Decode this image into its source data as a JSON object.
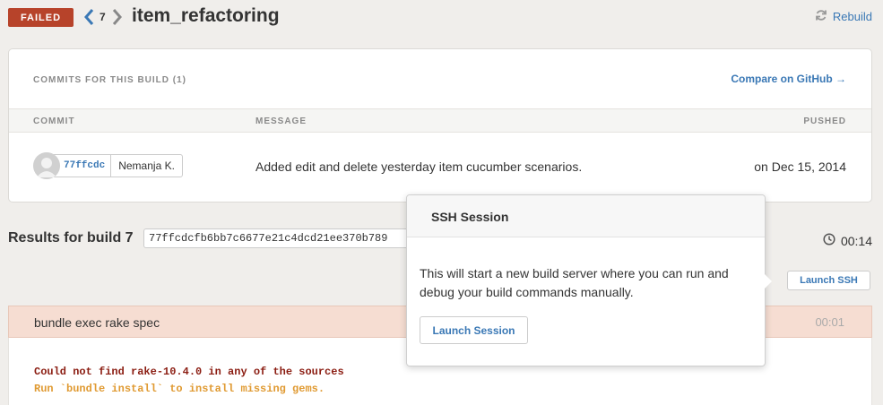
{
  "header": {
    "status": "FAILED",
    "build_number": "7",
    "branch": "item_refactoring",
    "rebuild_label": "Rebuild"
  },
  "commits": {
    "heading": "COMMITS FOR THIS BUILD (1)",
    "compare_label": "Compare on GitHub →",
    "columns": [
      "COMMIT",
      "MESSAGE",
      "PUSHED"
    ],
    "rows": [
      {
        "hash": "77ffcdc",
        "author": "Nemanja K.",
        "message": "Added edit and delete yesterday item cucumber scenarios.",
        "pushed": "on Dec 15, 2014"
      }
    ]
  },
  "results": {
    "label": "Results for build 7",
    "full_hash": "77ffcdcfb6bb7c6677e21c4dcd21ee370b789",
    "duration": "00:14",
    "launch_ssh_label": "Launch SSH"
  },
  "step": {
    "command": "bundle exec rake spec",
    "time": "00:01",
    "output": [
      {
        "text": "Could not find rake-10.4.0 in any of the sources",
        "kind": "error"
      },
      {
        "text": "Run `bundle install` to install missing gems.",
        "kind": "warning"
      }
    ]
  },
  "popover": {
    "title": "SSH Session",
    "body": "This will start a new build server where you can run and debug your build commands manually.",
    "button_label": "Launch Session"
  },
  "colors": {
    "failed": "#b7432a",
    "link": "#3a78b5",
    "step_failed_bg": "#f6ddd2",
    "error_text": "#8b1d12",
    "warning_text": "#e09a32"
  },
  "icons": {
    "prev": "chevron-left-icon",
    "next": "chevron-right-icon",
    "rebuild": "refresh-icon",
    "duration": "clock-icon",
    "avatar": "user-avatar"
  }
}
